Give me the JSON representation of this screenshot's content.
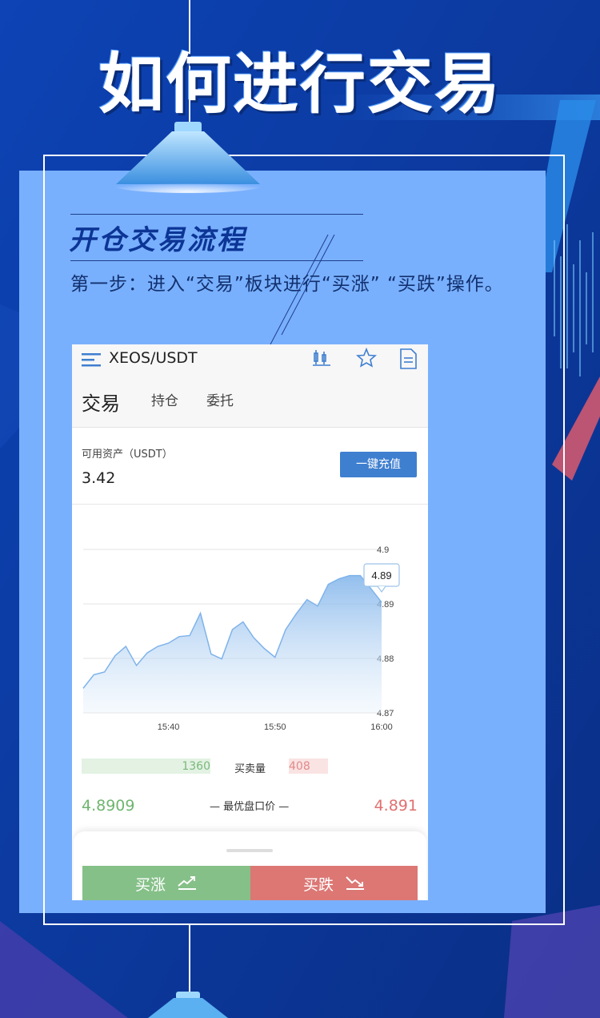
{
  "page": {
    "title": "如何进行交易",
    "section_title": "开仓交易流程",
    "step_text": "第一步：进入“交易”板块进行“买涨” “买跌”操作。"
  },
  "app": {
    "pair": "XEOS/USDT",
    "tabs": [
      {
        "label": "交易"
      },
      {
        "label": "持仓"
      },
      {
        "label": "委托"
      }
    ],
    "asset_label": "可用资产（USDT）",
    "asset_value": "3.42",
    "charge_button": "一键充值",
    "volume": {
      "buy": "1360",
      "label": "买卖量",
      "sell": "408"
    },
    "best_bid": "4.8909",
    "best_label": "— 最优盘口价 —",
    "best_ask": "4.891",
    "buy_button": "买涨",
    "sell_button": "买跌"
  },
  "colors": {
    "background": "#0b3a9a",
    "panel": "#79b0fd",
    "buy": "#85c088",
    "sell": "#dc7774",
    "accent": "#3f7fd0"
  },
  "chart_data": {
    "type": "area",
    "x_ticks": [
      "15:40",
      "15:50",
      "16:00"
    ],
    "y_ticks": [
      "4.9",
      "4.89",
      "4.88",
      "4.87"
    ],
    "ylim": [
      4.87,
      4.9
    ],
    "tooltip": "4.89",
    "x": [
      "15:32",
      "15:33",
      "15:34",
      "15:35",
      "15:36",
      "15:37",
      "15:38",
      "15:39",
      "15:40",
      "15:41",
      "15:42",
      "15:43",
      "15:44",
      "15:45",
      "15:46",
      "15:47",
      "15:48",
      "15:49",
      "15:50",
      "15:51",
      "15:52",
      "15:53",
      "15:54",
      "15:55",
      "15:56",
      "15:57",
      "15:58",
      "15:59",
      "16:00"
    ],
    "values": [
      4.8745,
      4.877,
      4.8775,
      4.8805,
      4.8822,
      4.8787,
      4.881,
      4.8822,
      4.8828,
      4.884,
      4.8842,
      4.8883,
      4.8808,
      4.8799,
      4.8853,
      4.8867,
      4.8838,
      4.8818,
      4.8802,
      4.8853,
      4.8882,
      4.8908,
      4.8896,
      4.8936,
      4.8946,
      4.8952,
      4.8952,
      4.8928,
      4.8903
    ]
  }
}
